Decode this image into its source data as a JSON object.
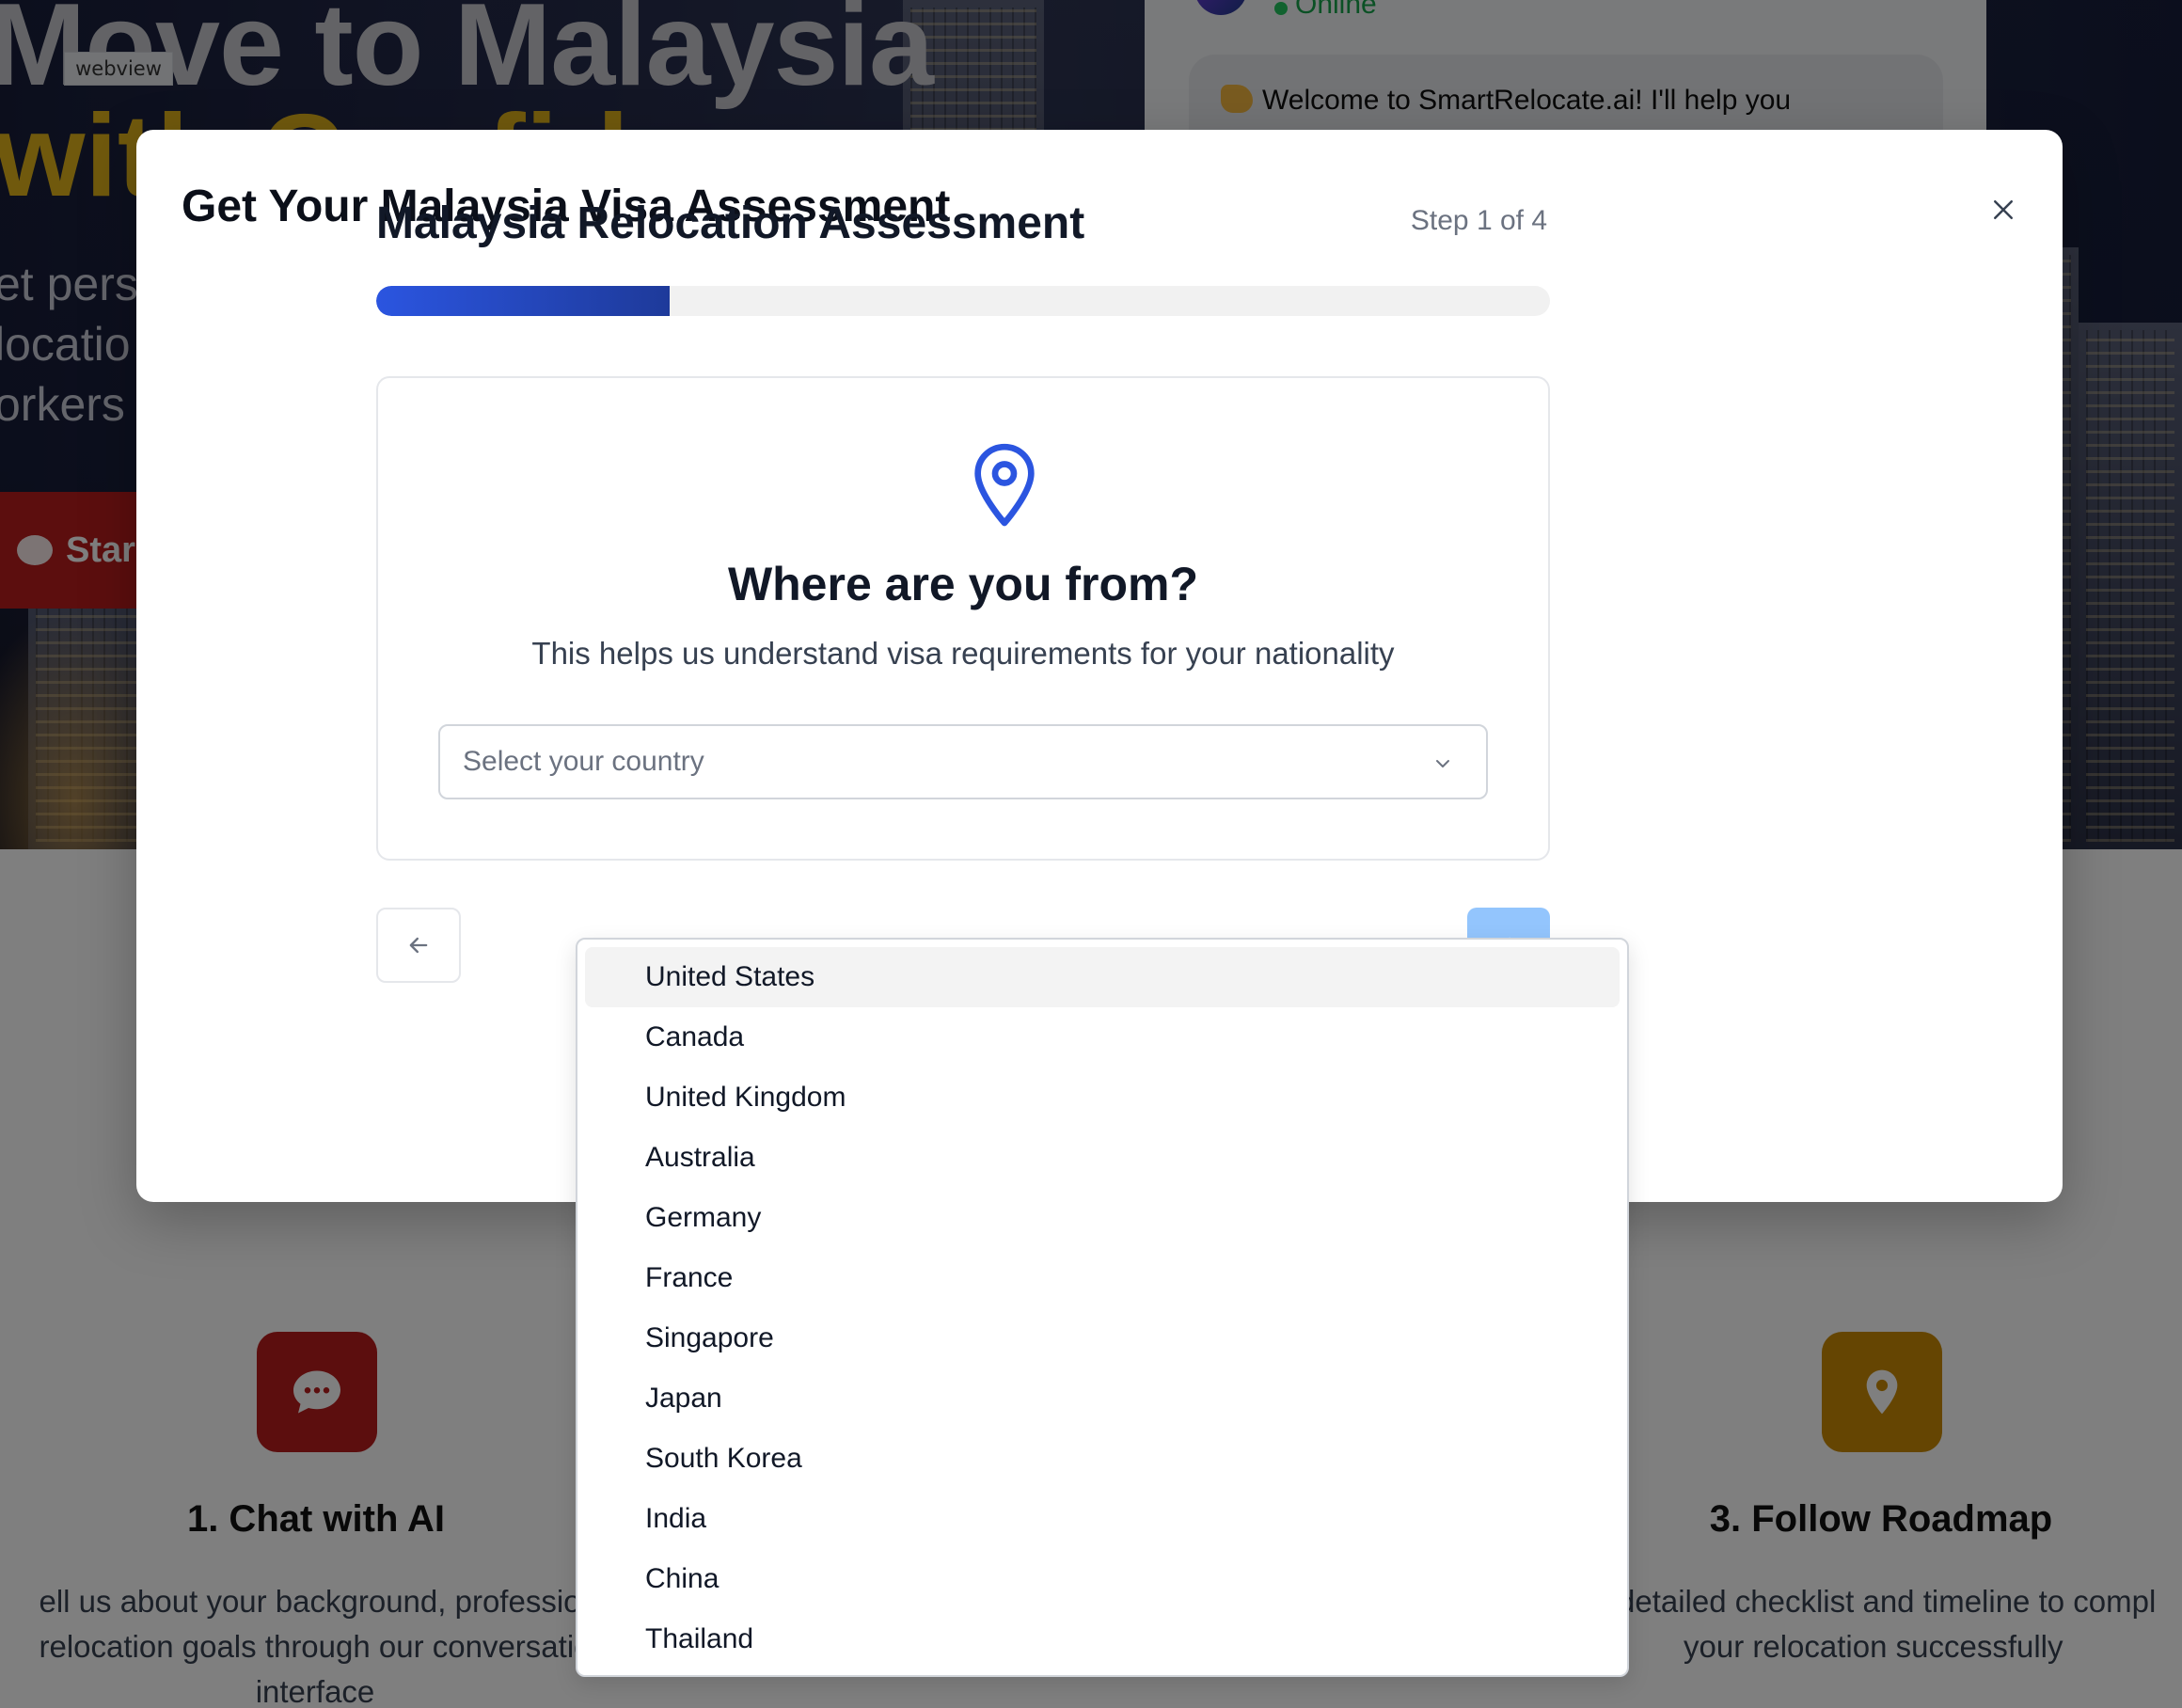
{
  "background": {
    "webview_label": "webview",
    "hero": {
      "title_line1": "Move to Malaysia",
      "title_line2": "with Confid",
      "subtitle_line1": "et pers",
      "subtitle_line2": "locatio",
      "subtitle_line3": "orkers",
      "cta_label": "Star"
    },
    "chat": {
      "status": "Online",
      "welcome": "Welcome to SmartRelocate.ai! I'll help you"
    },
    "features": [
      {
        "title": "1. Chat with AI",
        "desc_line1": "ell us about your background, professior",
        "desc_line2": "relocation goals through our conversatio",
        "desc_line3": "interface",
        "color": "#b91c1c",
        "icon": "chat-bubble-icon"
      },
      {
        "title": "3. Follow Roadmap",
        "desc_line1": "detailed checklist and timeline to compl",
        "desc_line2": "your relocation successfully",
        "color": "#ca8a04",
        "icon": "map-pin-icon"
      }
    ]
  },
  "modal": {
    "title": "Get Your Malaysia Visa Assessment",
    "close_icon": "close-icon",
    "assessment_title": "Malaysia Relocation Assessment",
    "step_text": "Step 1 of 4",
    "progress": {
      "current": 1,
      "total": 4,
      "fraction": 0.25
    },
    "question": "Where are you from?",
    "question_sub": "This helps us understand visa requirements for your nationality",
    "select_placeholder": "Select your country",
    "accent_color": "#2b55e0",
    "next_button_color": "#93c5fd"
  },
  "country_options": [
    "United States",
    "Canada",
    "United Kingdom",
    "Australia",
    "Germany",
    "France",
    "Singapore",
    "Japan",
    "South Korea",
    "India",
    "China",
    "Thailand"
  ],
  "highlighted_option": "United States"
}
